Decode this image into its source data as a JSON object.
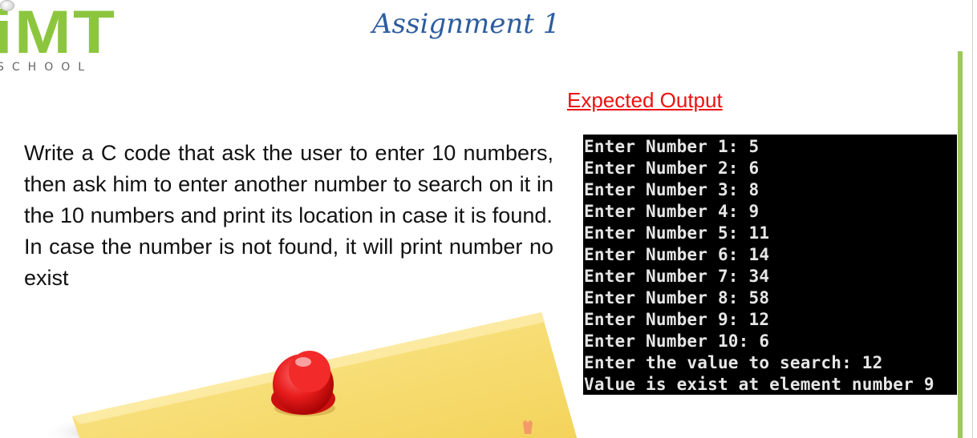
{
  "logo": {
    "letters": "iMT",
    "school": "SCHOOL",
    "brand_color": "#8cc63f"
  },
  "title": "Assignment 1",
  "expected_output_label": "Expected Output",
  "description": {
    "paragraph1": "Write a C code that ask the user to enter 10 numbers, then ask him to enter another number to search on it in the 10 numbers and print its location in case it is found.",
    "paragraph2": "In case the number is not found, it will print number no exist"
  },
  "console": {
    "background": "#000000",
    "text_color": "#e6e6e6",
    "lines": [
      "Enter Number 1: 5",
      "Enter Number 2: 6",
      "Enter Number 3: 8",
      "Enter Number 4: 9",
      "Enter Number 5: 11",
      "Enter Number 6: 14",
      "Enter Number 7: 34",
      "Enter Number 8: 58",
      "Enter Number 9: 12",
      "Enter Number 10: 6",
      "Enter the value to search: 12",
      "Value is exist at element number 9"
    ]
  },
  "colors": {
    "title": "#2e5d9e",
    "expected_label": "#ee1111",
    "accent_bar": "#9dc85a",
    "note_paper": "#f8e07a",
    "pin": "#e81c1c"
  }
}
